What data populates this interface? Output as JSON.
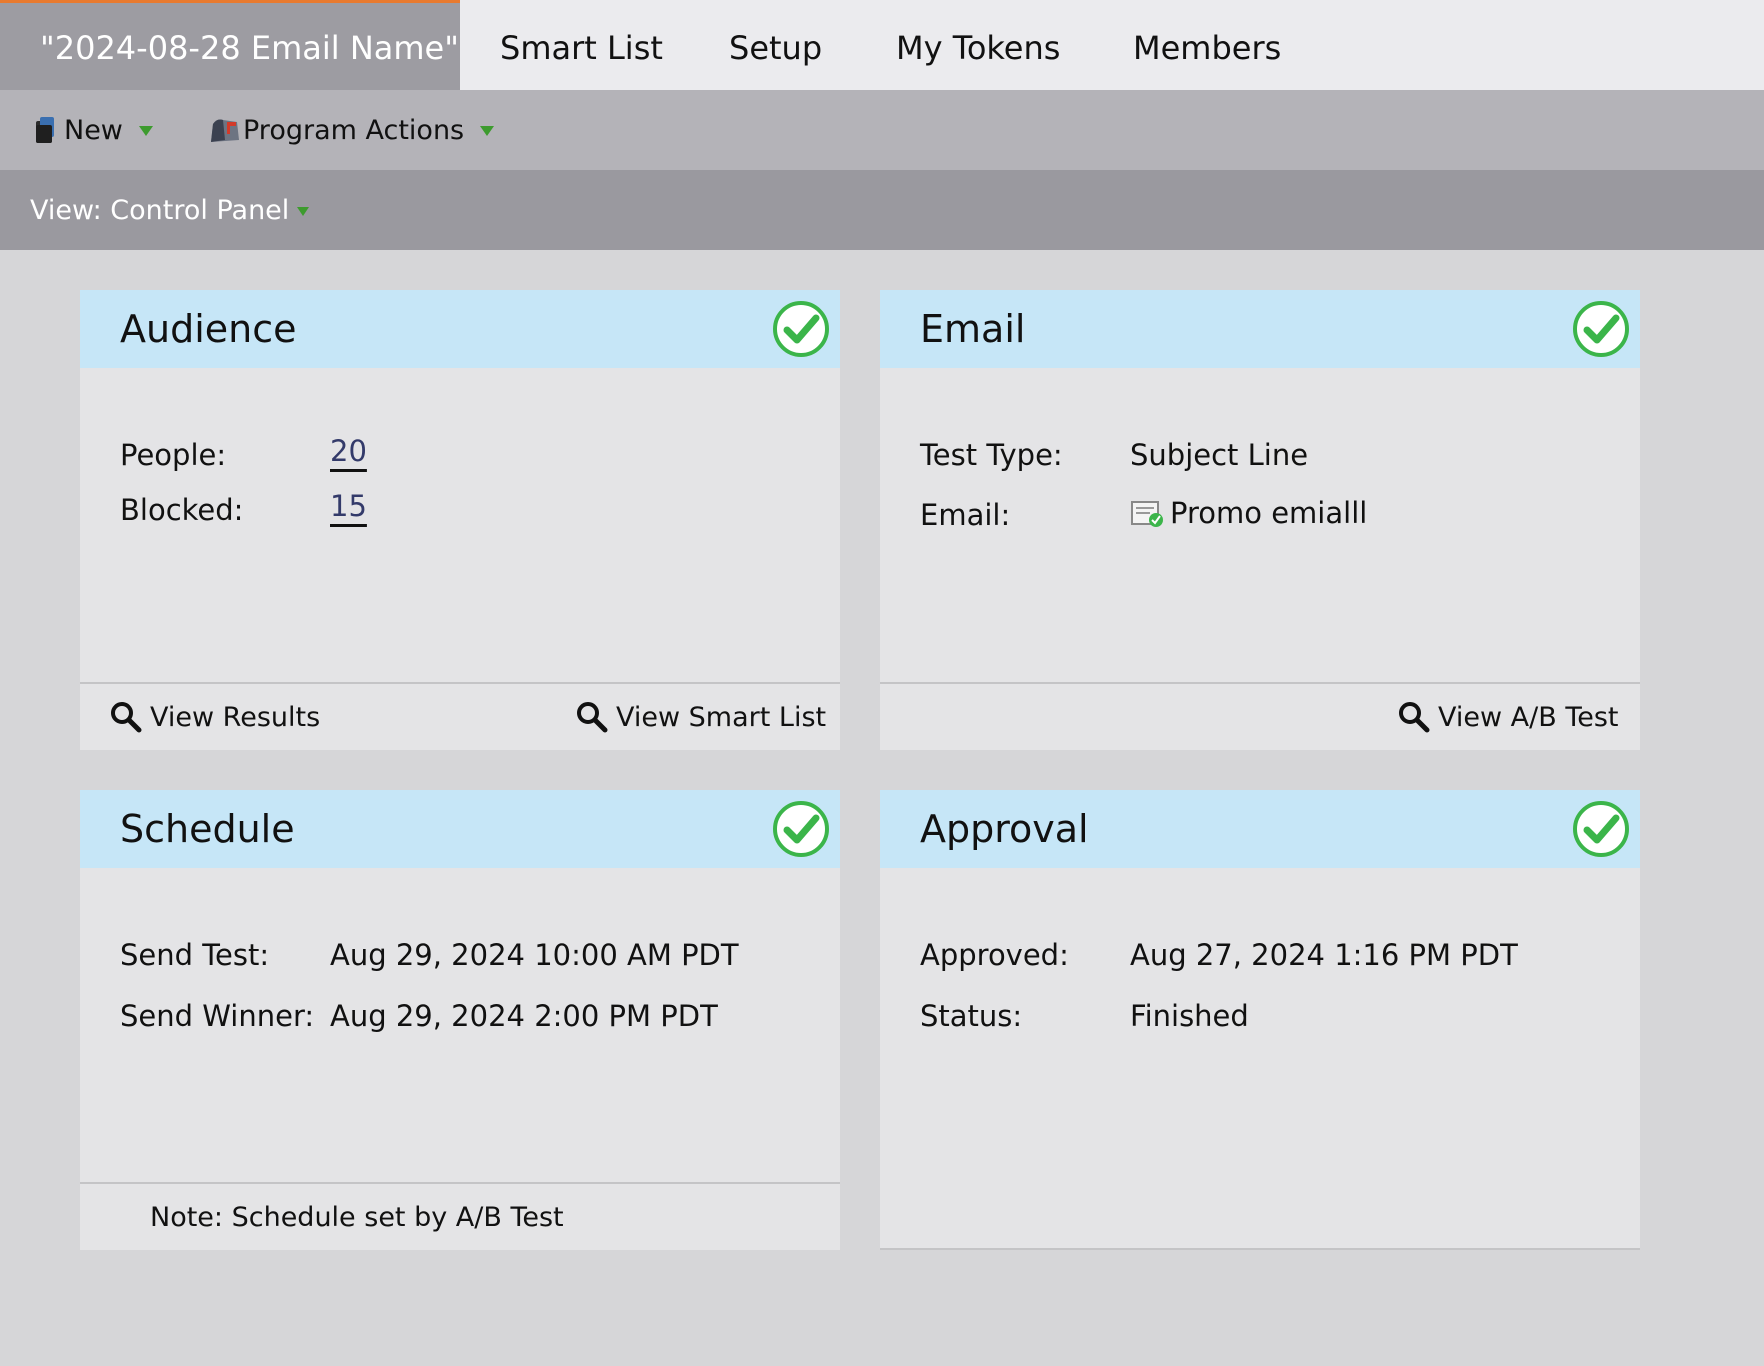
{
  "tabs": {
    "active": "\"2024-08-28 Email Name\"",
    "items": [
      "Smart List",
      "Setup",
      "My Tokens",
      "Members"
    ]
  },
  "toolbar": {
    "new_label": "New",
    "actions_label": "Program Actions"
  },
  "view": {
    "label": "View: Control Panel"
  },
  "audience": {
    "title": "Audience",
    "people_label": "People:",
    "people_value": "20",
    "blocked_label": "Blocked:",
    "blocked_value": "15",
    "view_results": "View Results",
    "view_smart_list": "View Smart List"
  },
  "email": {
    "title": "Email",
    "test_type_label": "Test Type:",
    "test_type_value": "Subject Line",
    "email_label": "Email:",
    "email_value": "Promo emialll",
    "view_ab_test": "View A/B Test"
  },
  "schedule": {
    "title": "Schedule",
    "send_test_label": "Send Test:",
    "send_test_value": "Aug 29, 2024 10:00 AM PDT",
    "send_winner_label": "Send Winner:",
    "send_winner_value": "Aug 29, 2024 2:00 PM PDT",
    "note": "Note: Schedule set by A/B Test"
  },
  "approval": {
    "title": "Approval",
    "approved_label": "Approved:",
    "approved_value": "Aug 27, 2024 1:16 PM PDT",
    "status_label": "Status:",
    "status_value": "Finished"
  },
  "colors": {
    "accent_tab": "#e87a2f",
    "card_header": "#c6e6f7",
    "check_green": "#3bb54a"
  }
}
